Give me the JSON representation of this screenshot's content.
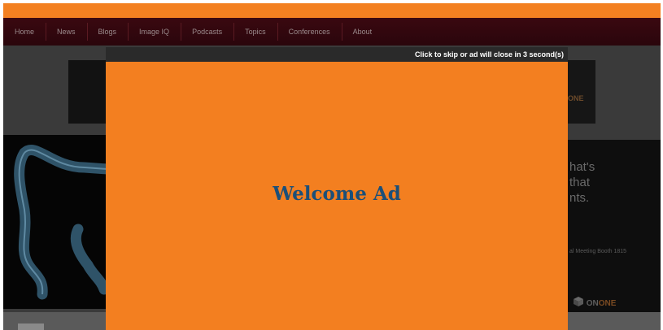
{
  "colors": {
    "brand_orange": "#f38021",
    "nav_background": "#2a060c",
    "ad_title": "#1c4f78"
  },
  "nav": {
    "items": [
      {
        "label": "Home"
      },
      {
        "label": "News"
      },
      {
        "label": "Blogs"
      },
      {
        "label": "Image IQ"
      },
      {
        "label": "Podcasts"
      },
      {
        "label": "Topics"
      },
      {
        "label": "Conferences"
      },
      {
        "label": "About"
      }
    ]
  },
  "ad_modal": {
    "skip_text": "Click to skip or ad will close in 3 second(s)",
    "title": "Welcome Ad"
  },
  "background": {
    "banner_right_text": "ONE",
    "hero_right": {
      "line1": "hat's",
      "line2": "that",
      "line3": "nts.",
      "caption": "al Meeting Booth 1815",
      "logo_prefix": "ON",
      "logo_accent": "ONE"
    }
  },
  "icons": {
    "hero_left_image": "colon-xray-illustration",
    "hero_right_logo": "cube-icon"
  }
}
